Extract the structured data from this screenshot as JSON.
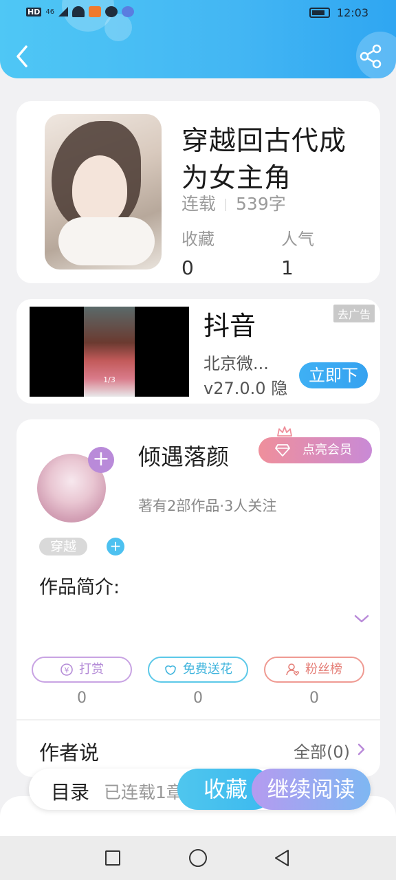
{
  "status_bar": {
    "time": "12:03",
    "net_label": "HD",
    "signal_label": "46"
  },
  "header": {
    "back_icon": "chevron-left-icon",
    "share_icon": "share-icon"
  },
  "book": {
    "title": "穿越回古代成为女主角",
    "status": "连载",
    "word_count": "539字",
    "stats": [
      {
        "label": "收藏",
        "value": "0"
      },
      {
        "label": "人气",
        "value": "1"
      }
    ]
  },
  "ad": {
    "app_name": "抖音",
    "tag": "去广告",
    "company": "北京微...",
    "version": "v27.0.0",
    "privacy": "隐",
    "cta": "立即下",
    "video_counter": "1/3"
  },
  "author": {
    "name": "倾遇落颜",
    "vip_button": "点亮会员",
    "meta": "著有2部作品·3人关注",
    "genre_tag": "穿越",
    "intro_label": "作品简介:",
    "actions": [
      {
        "label": "打赏",
        "count": "0",
        "icon": "yen-coin-icon"
      },
      {
        "label": "免费送花",
        "count": "0",
        "icon": "flower-icon"
      },
      {
        "label": "粉丝榜",
        "count": "0",
        "icon": "user-heart-icon"
      }
    ],
    "author_says": "作者说",
    "all_link": "全部(0)"
  },
  "bottom_bar": {
    "toc": "目录",
    "serial": "已连载1章",
    "collect": "收藏",
    "continue": "继续阅读"
  },
  "colors": {
    "header_gradient_start": "#4fc7f5",
    "header_gradient_end": "#2fa6f2",
    "vip_gradient_start": "#ef8f9b",
    "vip_gradient_end": "#c98ad6",
    "collect": "#3bb9ef",
    "continue_start": "#b59bf0"
  }
}
